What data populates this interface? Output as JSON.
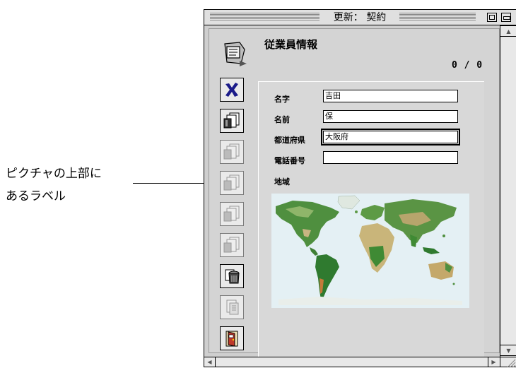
{
  "callout": {
    "line1": "ピクチャの上部に",
    "line2": "あるラベル"
  },
  "window": {
    "title": "更新： 契約"
  },
  "form": {
    "title": "従業員情報",
    "record_count": "0 / 0"
  },
  "fields": [
    {
      "label": "名字",
      "value": "吉田"
    },
    {
      "label": "名前",
      "value": "保"
    },
    {
      "label": "都道府県",
      "value": "大阪府"
    },
    {
      "label": "電話番号",
      "value": ""
    }
  ],
  "picture": {
    "label": "地域"
  },
  "toolbar": {
    "buttons": [
      {
        "icon": "delete-x-icon",
        "enabled": true
      },
      {
        "icon": "first-record-icon",
        "enabled": true
      },
      {
        "icon": "previous-record-icon",
        "enabled": false
      },
      {
        "icon": "next-record-icon",
        "enabled": false
      },
      {
        "icon": "last-record-icon",
        "enabled": false
      },
      {
        "icon": "add-record-icon",
        "enabled": false
      },
      {
        "icon": "trash-icon",
        "enabled": true
      },
      {
        "icon": "print-icon",
        "enabled": false
      },
      {
        "icon": "exit-door-icon",
        "enabled": true
      }
    ]
  }
}
